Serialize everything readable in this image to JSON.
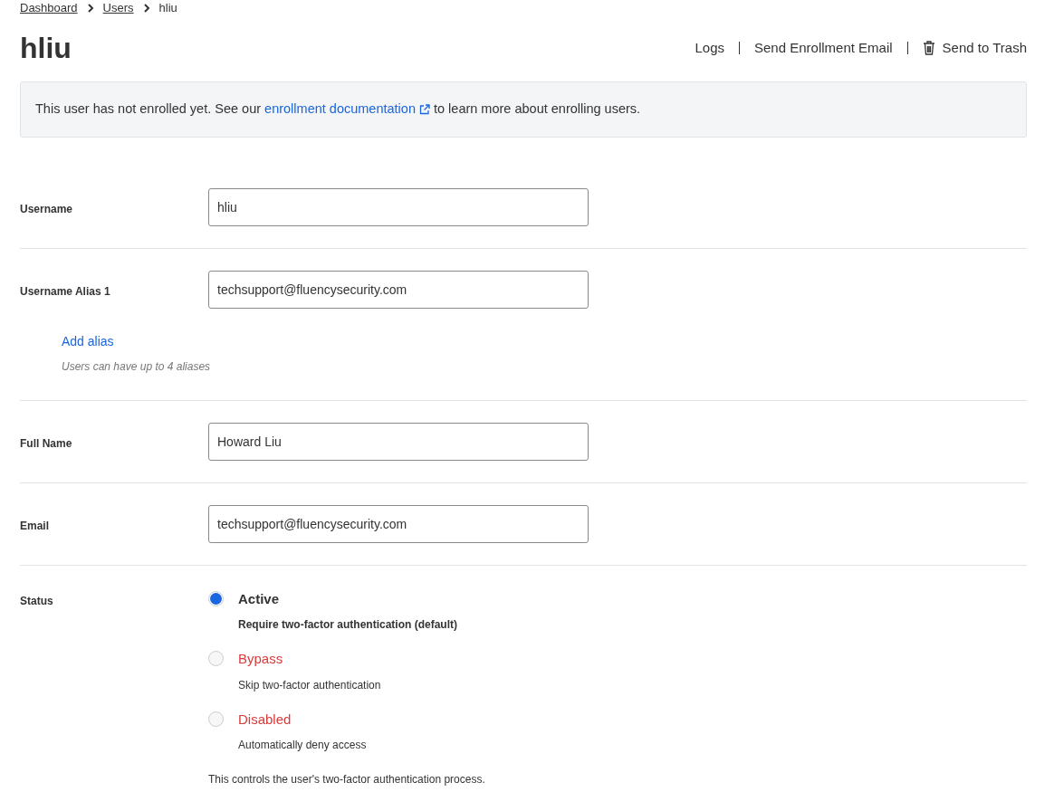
{
  "breadcrumb": [
    {
      "label": "Dashboard",
      "link": true
    },
    {
      "label": "Users",
      "link": true
    },
    {
      "label": "hliu",
      "link": false
    }
  ],
  "title": "hliu",
  "actions": [
    {
      "label": "Logs",
      "kind": "plain"
    },
    {
      "label": "Send Enrollment Email",
      "kind": "plain"
    },
    {
      "label": "Send to Trash",
      "kind": "trash"
    }
  ],
  "notice": {
    "before": "This user has not enrolled yet. See our",
    "link": "enrollment documentation",
    "after": "to learn more about enrolling users."
  },
  "fields": [
    {
      "label": "Username",
      "value": "hliu"
    },
    {
      "label": "Username Alias 1",
      "value": "techsupport@fluencysecurity.com",
      "add_link": "Add alias",
      "hint": "Users can have up to 4 aliases"
    },
    {
      "label": "Full Name",
      "value": "Howard Liu"
    },
    {
      "label": "Email",
      "value": "techsupport@fluencysecurity.com"
    }
  ],
  "status": {
    "label": "Status",
    "options": [
      {
        "label": "Active",
        "description": "Require two-factor authentication (default)",
        "selected": true,
        "kind": "normal"
      },
      {
        "label": "Bypass",
        "description": "Skip two-factor authentication",
        "selected": false,
        "kind": "danger"
      },
      {
        "label": "Disabled",
        "description": "Automatically deny access",
        "selected": false,
        "kind": "danger"
      }
    ],
    "help": "This controls the user's two-factor authentication process."
  }
}
